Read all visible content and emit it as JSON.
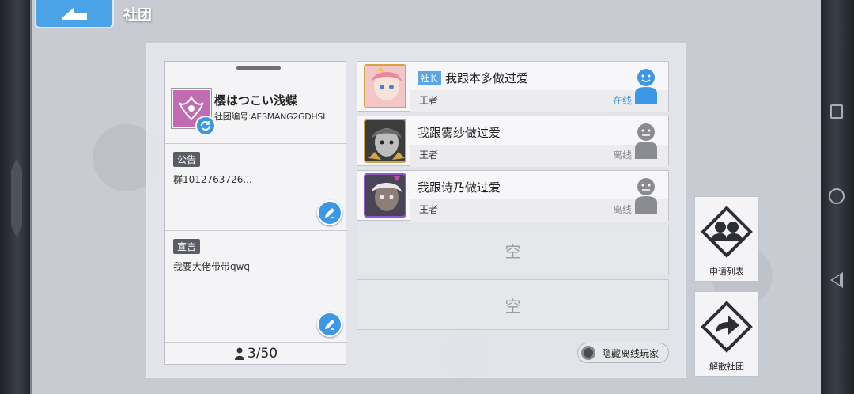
{
  "header": {
    "title": "社团"
  },
  "club": {
    "name": "樱はつこい浅蝶",
    "id_text": "社团编号:AESMANG2GDHSL",
    "notice_label": "公告",
    "notice_text": "群1012763726...",
    "declaration_label": "宣言",
    "declaration_text": "我要大佬带带qwq",
    "member_count": "3/50"
  },
  "members": [
    {
      "name": "我跟本多做过爱",
      "role": "社长",
      "rank": "王者",
      "status": "在线"
    },
    {
      "name": "我跟雾纱做过爱",
      "role": "",
      "rank": "王者",
      "status": "离线"
    },
    {
      "name": "我跟诗乃做过爱",
      "role": "",
      "rank": "王者",
      "status": "离线"
    }
  ],
  "empty_slots": [
    "空",
    "空"
  ],
  "hide_offline_label": "隐藏离线玩家",
  "side_buttons": {
    "apply_list_label": "申请列表",
    "dissolve_label": "解散社团"
  },
  "colors": {
    "accent": "#3d97e3",
    "online": "#3d97e3",
    "offline": "#8a8c92",
    "emblem": "#c06bb2"
  },
  "icons": {
    "back": "back-arrow-icon",
    "refresh": "refresh-icon",
    "edit": "pencil-icon",
    "person": "person-icon",
    "apply": "group-icon",
    "dissolve": "exit-arrow-icon"
  }
}
